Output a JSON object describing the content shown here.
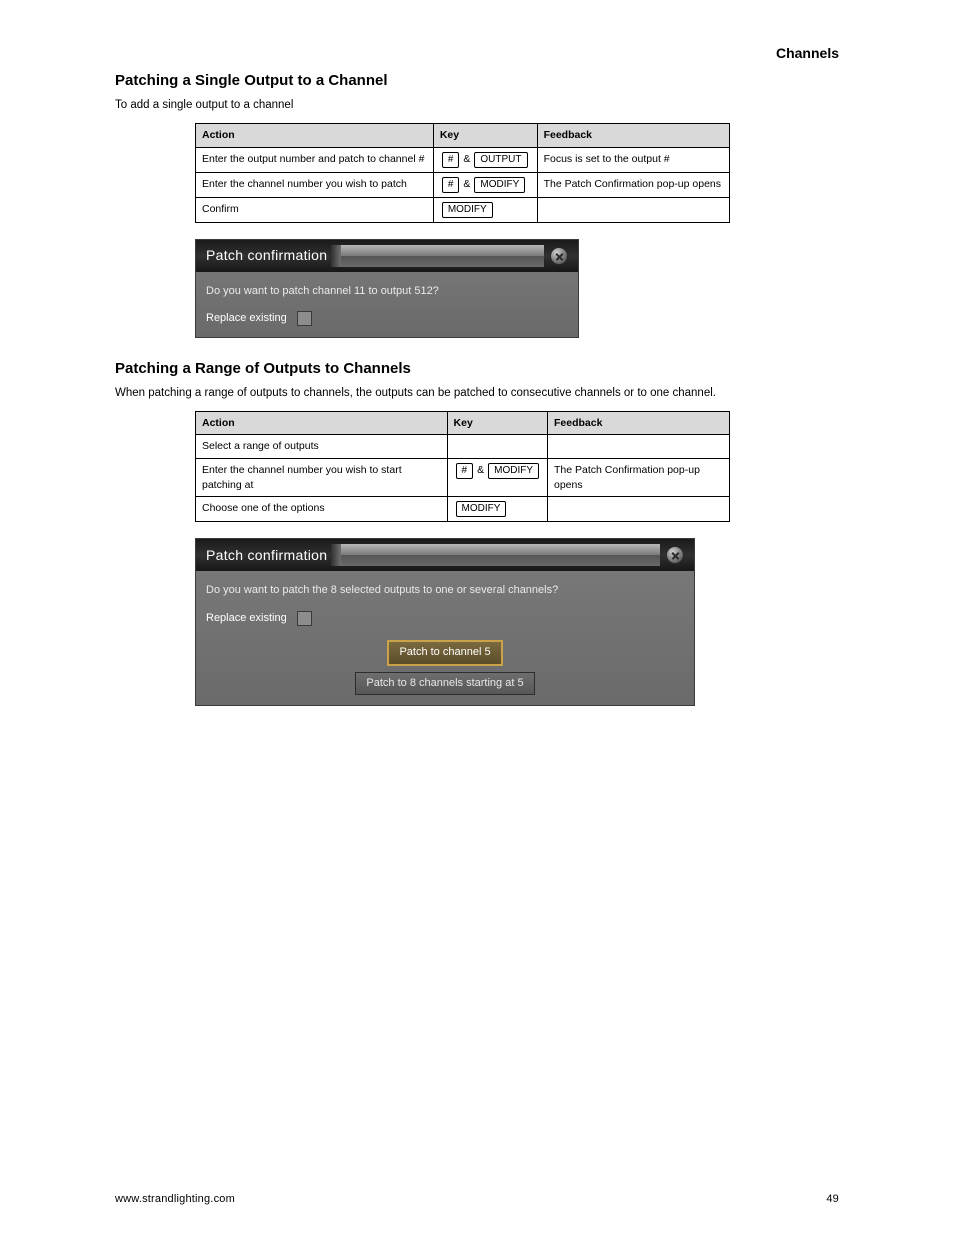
{
  "header_right": "Channels",
  "section1": {
    "heading": "Patching a Single Output to a Channel",
    "intro": "To add a single output to a channel",
    "table": {
      "cols": [
        "Action",
        "Key",
        "Feedback"
      ],
      "rows": [
        {
          "action": "Enter the output number and patch to channel #",
          "keys": [
            {
              "type": "key",
              "text": "#"
            },
            {
              "type": "amp"
            },
            {
              "type": "key",
              "text": "OUTPUT"
            }
          ],
          "feedback": "Focus is set to the output #"
        },
        {
          "action": "Enter the channel number you wish to patch",
          "keys": [
            {
              "type": "key",
              "text": "#"
            },
            {
              "type": "amp"
            },
            {
              "type": "key",
              "text": "MODIFY"
            }
          ],
          "feedback": "The Patch Confirmation pop-up opens"
        },
        {
          "action": "Confirm",
          "keys": [
            {
              "type": "key",
              "text": "MODIFY"
            }
          ],
          "feedback": ""
        }
      ]
    }
  },
  "dialog1": {
    "title": "Patch confirmation",
    "question": "Do you want to patch channel 11 to output 512?",
    "checkbox_label": "Replace existing"
  },
  "section2": {
    "heading": "Patching a Range of Outputs to Channels",
    "intro": "When patching a range of outputs to channels, the outputs can be patched to consecutive channels or to one channel.",
    "table": {
      "cols": [
        "Action",
        "Key",
        "Feedback"
      ],
      "rows": [
        {
          "action": "Select a range of outputs",
          "keys": [],
          "feedback": ""
        },
        {
          "action": "Enter the channel number you wish to start patching at",
          "keys": [
            {
              "type": "key",
              "text": "#"
            },
            {
              "type": "amp"
            },
            {
              "type": "key",
              "text": "MODIFY"
            }
          ],
          "feedback": "The Patch Confirmation pop-up opens"
        },
        {
          "action": "Choose one of the options",
          "keys": [
            {
              "type": "key",
              "text": "MODIFY"
            }
          ],
          "feedback": ""
        }
      ]
    }
  },
  "dialog2": {
    "title": "Patch confirmation",
    "question": "Do you want to patch the 8 selected outputs to one or several channels?",
    "checkbox_label": "Replace existing",
    "btn_primary": "Patch to channel 5",
    "btn_secondary": "Patch to 8 channels starting at 5"
  },
  "footer_left": "www.strandlighting.com",
  "footer_right": "49"
}
